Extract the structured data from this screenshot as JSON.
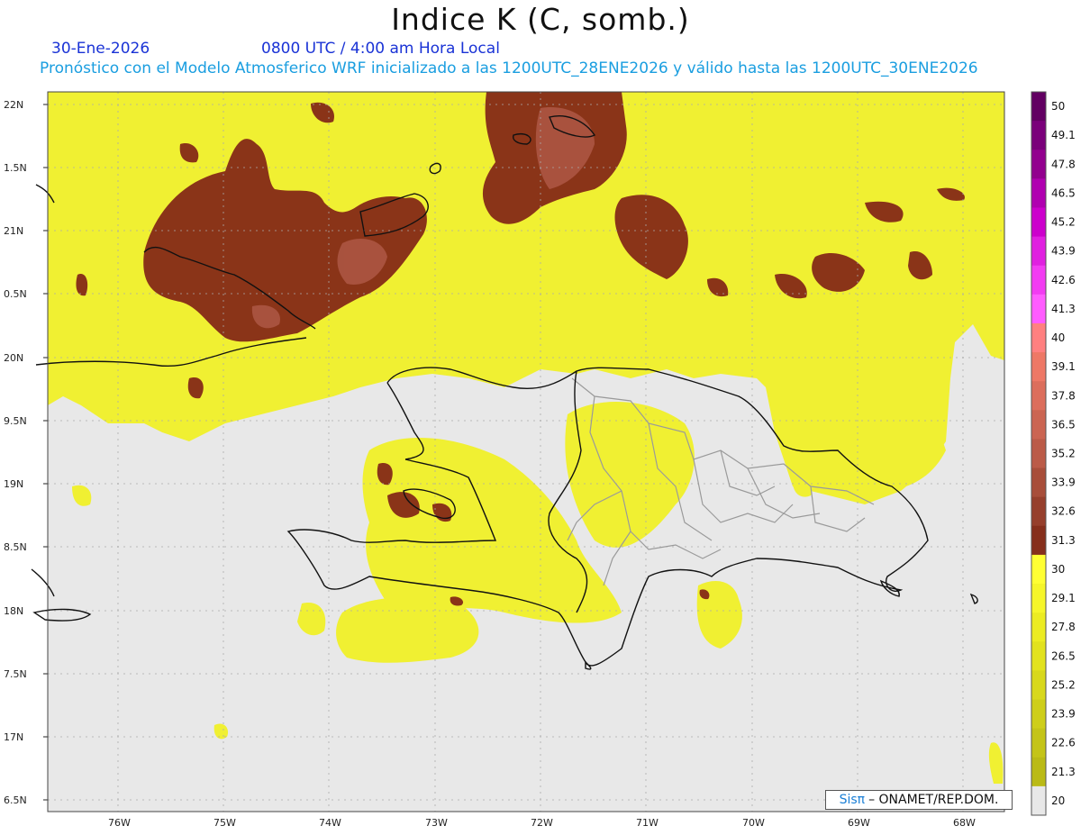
{
  "header": {
    "title": "Indice K (C, somb.)",
    "date": "30-Ene-2026",
    "time": "0800 UTC / 4:00 am Hora Local",
    "description": "Pronóstico con el Modelo Atmosferico WRF inicializado a las 1200UTC_28ENE2026 y válido hasta las  1200UTC_30ENE2026"
  },
  "map": {
    "lat_labels": [
      "22N",
      "1.5N",
      "21N",
      "0.5N",
      "20N",
      "9.5N",
      "19N",
      "8.5N",
      "18N",
      "7.5N",
      "17N",
      "6.5N"
    ],
    "lon_labels": [
      "76W",
      "75W",
      "74W",
      "73W",
      "72W",
      "71W",
      "70W",
      "69W",
      "68W"
    ],
    "colors": {
      "no_data": "#e8e8e8",
      "yellow": "#f0f032",
      "brown": "#8a3418",
      "land_border": "#111111",
      "province_border": "#999999"
    }
  },
  "colorbar": {
    "labels": [
      "50",
      "49.1",
      "47.8",
      "46.5",
      "45.2",
      "43.9",
      "42.6",
      "41.3",
      "40",
      "39.1",
      "37.8",
      "36.5",
      "35.2",
      "33.9",
      "32.6",
      "31.3",
      "30",
      "29.1",
      "27.8",
      "26.5",
      "25.2",
      "23.9",
      "22.6",
      "21.3",
      "20"
    ],
    "colors": [
      "#620062",
      "#7a007a",
      "#92008e",
      "#b000b0",
      "#cc00cc",
      "#e020e0",
      "#f23cf2",
      "#ff5cff",
      "#ff8080",
      "#ee7866",
      "#dc6e5c",
      "#cb6552",
      "#bb5b48",
      "#a84e3a",
      "#963f2c",
      "#862f1c",
      "#ffff33",
      "#f6f62a",
      "#ecec22",
      "#e2e21e",
      "#d8d81c",
      "#cece1a",
      "#c4c418",
      "#baba16",
      "#e8e8e8"
    ]
  },
  "credit": {
    "logo": "Sisπ",
    "text": "– ONAMET/REP.DOM."
  }
}
